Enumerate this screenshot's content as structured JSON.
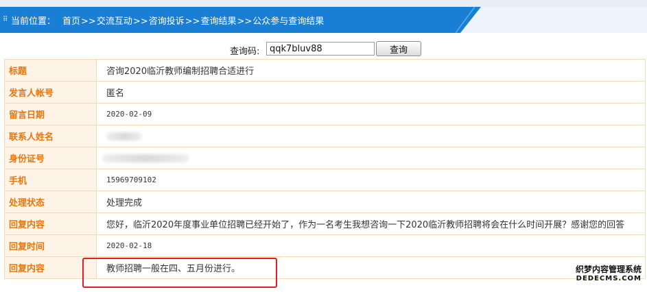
{
  "breadcrumb": {
    "label": "当前位置：",
    "items": [
      "首页",
      "交流互动",
      "咨询投诉",
      "查询结果",
      "公众参与查询结果"
    ],
    "separator": ">>"
  },
  "search": {
    "label": "查询码:",
    "value": "qqk7bluv88",
    "button_label": "查询"
  },
  "rows": [
    {
      "label": "标题",
      "value": "咨询2020临沂教师编制招聘合适进行"
    },
    {
      "label": "发言人帐号",
      "value": "匿名"
    },
    {
      "label": "留言日期",
      "value": "2020-02-09"
    },
    {
      "label": "联系人姓名",
      "value": ""
    },
    {
      "label": "身份证号",
      "value": ""
    },
    {
      "label": "手机",
      "value": "15969709102"
    },
    {
      "label": "处理状态",
      "value": "处理完成"
    },
    {
      "label": "回复内容",
      "value": "您好，临沂2020年度事业单位招聘已经开始了，作为一名考生我想咨询一下2020临沂教师招聘将会在什么时间开展？感谢您的回答"
    },
    {
      "label": "回复时间",
      "value": "2020-02-18"
    },
    {
      "label": "回复内容",
      "value": "教师招聘一般在四、五月份进行。"
    }
  ],
  "watermark": {
    "line1": "织梦内容管理系统",
    "line2": "DEDECMS.COM"
  },
  "colors": {
    "header_bg": "#1a7fd4",
    "label_text": "#e8760d",
    "label_bg": "#fdf3e6",
    "border": "#f5d9b8",
    "highlight": "#e02020"
  }
}
